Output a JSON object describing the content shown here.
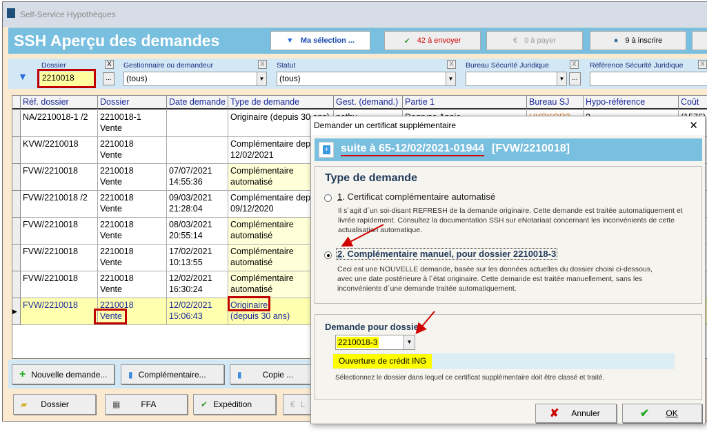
{
  "window": {
    "title": "Self-Service Hypothèques"
  },
  "header": {
    "title": "SSH  Aperçu des demandes",
    "buttons": [
      {
        "label": "Ma sélection ...",
        "icon": "filter-icon"
      },
      {
        "label": "42 à envoyer",
        "icon": "send-icon",
        "color": "#d00000"
      },
      {
        "label": "0 à payer",
        "icon": "euro-icon"
      },
      {
        "label": "9 à inscrire",
        "icon": "globe-icon"
      }
    ]
  },
  "filters": {
    "dossier_label": "Dossier",
    "dossier_value": "2210018",
    "gestionnaire_label": "Gestionnaire ou demandeur",
    "gestionnaire_value": "(tous)",
    "statut_label": "Statut",
    "statut_value": "(tous)",
    "bureau_label": "Bureau Sécurité Juridique",
    "bureau_value": "",
    "reference_label": "Référence Sécurité Juridique",
    "reference_value": "",
    "clear": "X",
    "more": "..."
  },
  "grid": {
    "columns": [
      "Réf. dossier",
      "Dossier",
      "Date demande",
      "Type de demande",
      "Gest. (demand.)",
      "Partie 1",
      "Bureau SJ",
      "Hypo-référence",
      "Coût"
    ],
    "rows": [
      {
        "ref": "NA/2210018-1 /2",
        "dossier": "2210018-1",
        "dossier2": "Vente",
        "date": "",
        "time": "",
        "type": "Originaire (depuis 30 ans)",
        "type2": "",
        "gest": "nathy",
        "partie": "Degryse Annie",
        "bureau": "HYPKOR2",
        "hypo": "2",
        "cout": "(1576)"
      },
      {
        "ref": "KVW/2210018",
        "dossier": "2210018",
        "dossier2": "Vente",
        "date": "",
        "time": "",
        "type": "Complémentaire depuis",
        "type2": "12/02/2021"
      },
      {
        "ref": "FVW/2210018",
        "dossier": "2210018",
        "dossier2": "Vente",
        "date": "07/07/2021",
        "time": "14:55:36",
        "type": "Complémentaire",
        "type2": "automatisé"
      },
      {
        "ref": "FVW/2210018 /2",
        "dossier": "2210018",
        "dossier2": "Vente",
        "date": "09/03/2021",
        "time": "21:28:04",
        "type": "Complémentaire depuis",
        "type2": "09/12/2020"
      },
      {
        "ref": "FVW/2210018",
        "dossier": "2210018",
        "dossier2": "Vente",
        "date": "08/03/2021",
        "time": "20:55:14",
        "type": "Complémentaire",
        "type2": "automatisé"
      },
      {
        "ref": "FVW/2210018",
        "dossier": "2210018",
        "dossier2": "Vente",
        "date": "17/02/2021",
        "time": "10:13:55",
        "type": "Complémentaire",
        "type2": "automatisé"
      },
      {
        "ref": "FVW/2210018",
        "dossier": "2210018",
        "dossier2": "Vente",
        "date": "12/02/2021",
        "time": "16:30:24",
        "type": "Complémentaire",
        "type2": "automatisé"
      },
      {
        "ref": "FVW/2210018",
        "dossier": "2210018",
        "dossier2": "Vente",
        "date": "12/02/2021",
        "time": "15:06:43",
        "type": "Originaire",
        "type2": "(depuis 30 ans)",
        "selected": true
      }
    ]
  },
  "actions": {
    "new": "Nouvelle demande...",
    "complementaire": "Complémentaire...",
    "copie": "Copie ...",
    "dossier": "Dossier",
    "ffa": "FFA",
    "expedition": "Expédition",
    "l": "L"
  },
  "dialog": {
    "title": "Demander un certificat supplémentaire",
    "close": "✕",
    "band_ref": "suite à 65-12/02/2021-01944",
    "band_dossier": "[FVW/2210018]",
    "section_title": "Type de demande",
    "option1_num": "1",
    "option1_label": ". Certificat complémentaire automatisé",
    "option1_desc": "Il s´agit d´un soi-disant REFRESH de la demande originaire. Cette demande est traitée automatiquement et livrée rapidement. Consultez la documentation SSH sur eNotariaat concernant les inconvénients de cette actualisation automatique.",
    "option2_num": "2",
    "option2_label": ". Complémentaire manuel, pour dossier 2210018-3",
    "option2_desc": "Ceci est une NOUVELLE demande, basée sur les données actuelles du dossier choisi ci-dessous, avec une date postérieure à l´état originaire. Cette demande est traitée manuellement, sans les inconvénients d´une demande traitée automatiquement.",
    "selected_option": 2,
    "dossier_label": "Demande pour dossier",
    "dossier_value": "2210018-3",
    "dossier_info": "Ouverture de crédit  ING",
    "hint": "Sélectionnez le dossier dans lequel ce certificat supplémentaire doit être classé et traité.",
    "cancel": "Annuler",
    "ok": "OK"
  },
  "colors": {
    "header_blue": "#79bfe0",
    "highlight_yellow": "#ffff00",
    "annotation_red": "#c00000"
  }
}
